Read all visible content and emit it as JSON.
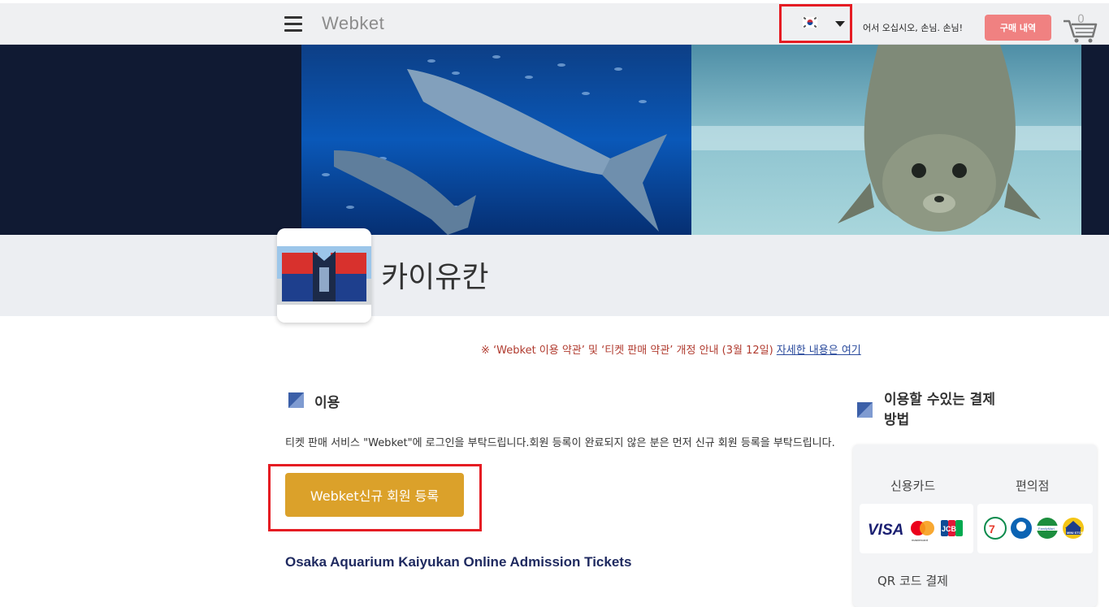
{
  "header": {
    "logo": "Webket",
    "greeting": "어서 오십시오, 손님. 손님!",
    "purchase_label": "구매 내역",
    "cart_count": "0",
    "language_flag": "korea-flag-icon"
  },
  "venue": {
    "name": "카이유칸"
  },
  "notice": {
    "text": "※ ‘Webket 이용 약관’ 및 ‘티켓 판매 약관’ 개정 안내 (3월 12일) ",
    "link_label": "자세한 내용은 여기"
  },
  "usage": {
    "title": "이용",
    "description": "티켓 판매 서비스 \"Webket\"에 로그인을 부탁드립니다.회원 등록이 완료되지 않은 분은 먼저 신규 회원 등록을 부탁드립니다.",
    "signup_label": "Webket신규 회원 등록"
  },
  "product": {
    "title": "Osaka Aquarium Kaiyukan Online Admission Tickets"
  },
  "payment": {
    "title": "이용할 수있는 결제 방법",
    "credit_card_label": "신용카드",
    "convenience_label": "편의점",
    "qr_label": "QR 코드 결제",
    "card_brands": [
      "VISA",
      "mastercard",
      "JCB"
    ],
    "stores": [
      "7-Eleven",
      "Lawson",
      "FamilyMart",
      "MINI STOP"
    ]
  },
  "colors": {
    "accent_red": "#e51c23",
    "purchase_button": "#f08181",
    "signup_button": "#dba12a",
    "hero_bg": "#101a33"
  }
}
